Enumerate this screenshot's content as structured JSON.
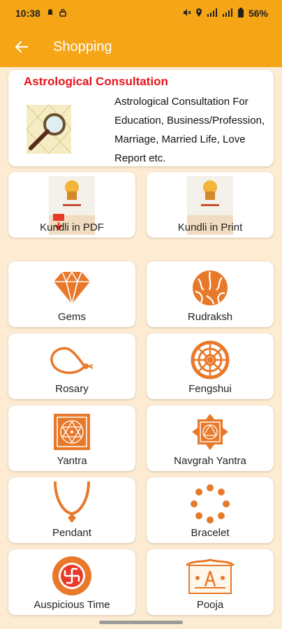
{
  "status_bar": {
    "time": "10:38",
    "battery": "56%"
  },
  "app_bar": {
    "title": "Shopping"
  },
  "consultation": {
    "title": "Astrological Consultation",
    "description": "Astrological Consultation For Education, Business/Profession, Marriage, Married Life, Love Report etc."
  },
  "items": [
    {
      "label": "Kundli in PDF",
      "icon": "kundli-pdf-icon"
    },
    {
      "label": "Kundli in Print",
      "icon": "kundli-print-icon"
    },
    {
      "label": "Gems",
      "icon": "diamond-icon"
    },
    {
      "label": "Rudraksh",
      "icon": "rudraksh-icon"
    },
    {
      "label": "Rosary",
      "icon": "rosary-icon"
    },
    {
      "label": "Fengshui",
      "icon": "fengshui-wheel-icon"
    },
    {
      "label": "Yantra",
      "icon": "yantra-icon"
    },
    {
      "label": "Navgrah Yantra",
      "icon": "navgrah-yantra-icon"
    },
    {
      "label": "Pendant",
      "icon": "pendant-icon"
    },
    {
      "label": "Bracelet",
      "icon": "bracelet-icon"
    },
    {
      "label": "Auspicious Time",
      "icon": "swastik-icon"
    },
    {
      "label": "Pooja",
      "icon": "pooja-icon"
    }
  ],
  "colors": {
    "accent": "#f5a515",
    "icon_orange": "#e8792a",
    "title_red": "#e8141c",
    "background": "#fdecd2"
  }
}
